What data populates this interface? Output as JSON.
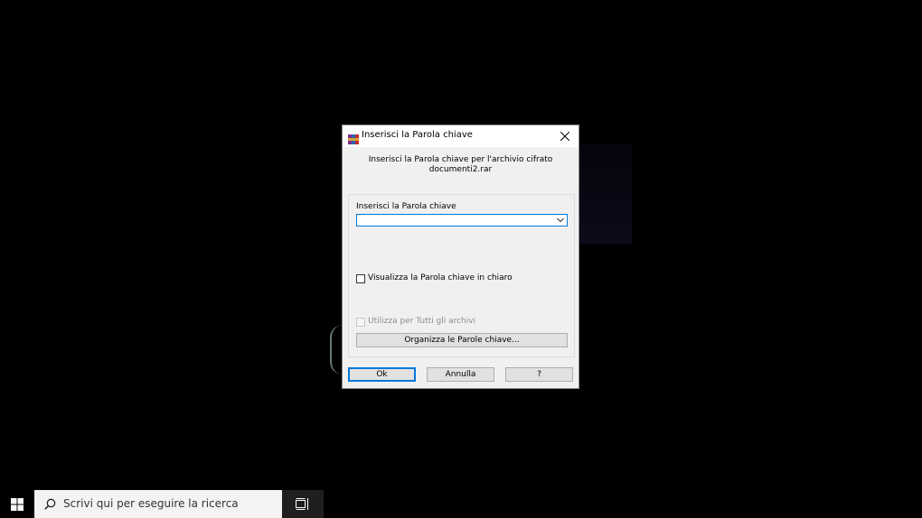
{
  "dialog": {
    "title": "Inserisci la Parola chiave",
    "prompt_line1": "Inserisci la Parola chiave per l'archivio cifrato",
    "prompt_line2": "documenti2.rar",
    "password_label": "Inserisci la Parola chiave",
    "password_value": "",
    "show_password_label": "Visualizza la Parola chiave in chiaro",
    "show_password_checked": false,
    "use_all_label": "Utilizza per Tutti gli archivi",
    "use_all_checked": false,
    "use_all_enabled": false,
    "organize_label": "Organizza le Parole chiave...",
    "ok_label": "Ok",
    "cancel_label": "Annulla",
    "help_label": "?"
  },
  "taskbar": {
    "search_placeholder": "Scrivi qui per eseguire la ricerca"
  },
  "icons": {
    "app": "winrar-icon",
    "close": "close-icon",
    "dropdown": "chevron-down-icon",
    "start": "windows-logo-icon",
    "search": "search-icon",
    "task_view": "task-view-icon"
  },
  "colors": {
    "accent": "#0078d7",
    "dialog_bg": "#f0f0f0",
    "desktop_bg": "#000000"
  }
}
